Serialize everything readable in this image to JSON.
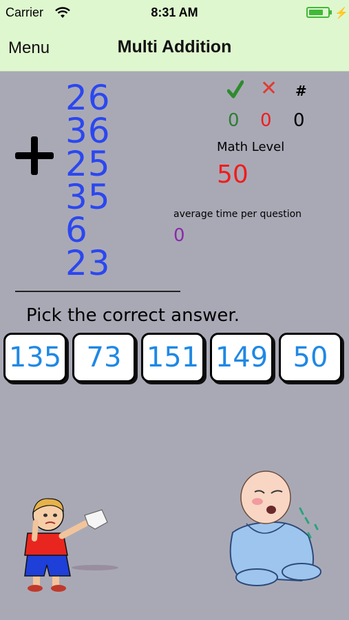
{
  "status_bar": {
    "carrier": "Carrier",
    "time": "8:31 AM",
    "battery_level": 0.75,
    "wifi_icon": "wifi-icon",
    "charging_icon": "bolt-icon"
  },
  "nav": {
    "menu_label": "Menu",
    "title": "Multi Addition"
  },
  "problem": {
    "operator": "+",
    "operands": [
      "26",
      "36",
      "25",
      "35",
      "6",
      "23"
    ]
  },
  "score": {
    "correct_icon": "checkmark-icon",
    "wrong_icon": "x-icon",
    "total_symbol": "#",
    "correct": "0",
    "wrong": "0",
    "total": "0",
    "correct_color": "#2e7d32",
    "wrong_color": "#f01c1c",
    "total_color": "#000000"
  },
  "math_level": {
    "label": "Math Level",
    "value": "50"
  },
  "average_time": {
    "label": "average time per question",
    "value": "0"
  },
  "prompt": "Pick the correct answer.",
  "answers": [
    "135",
    "73",
    "151",
    "149",
    "50"
  ],
  "colors": {
    "background": "#a9a9b6",
    "bar": "#dff7cf",
    "operand": "#2b47f0",
    "answer_text": "#1f88e5"
  },
  "illustrations": [
    "crying-boy-illustration",
    "crying-baby-illustration"
  ]
}
